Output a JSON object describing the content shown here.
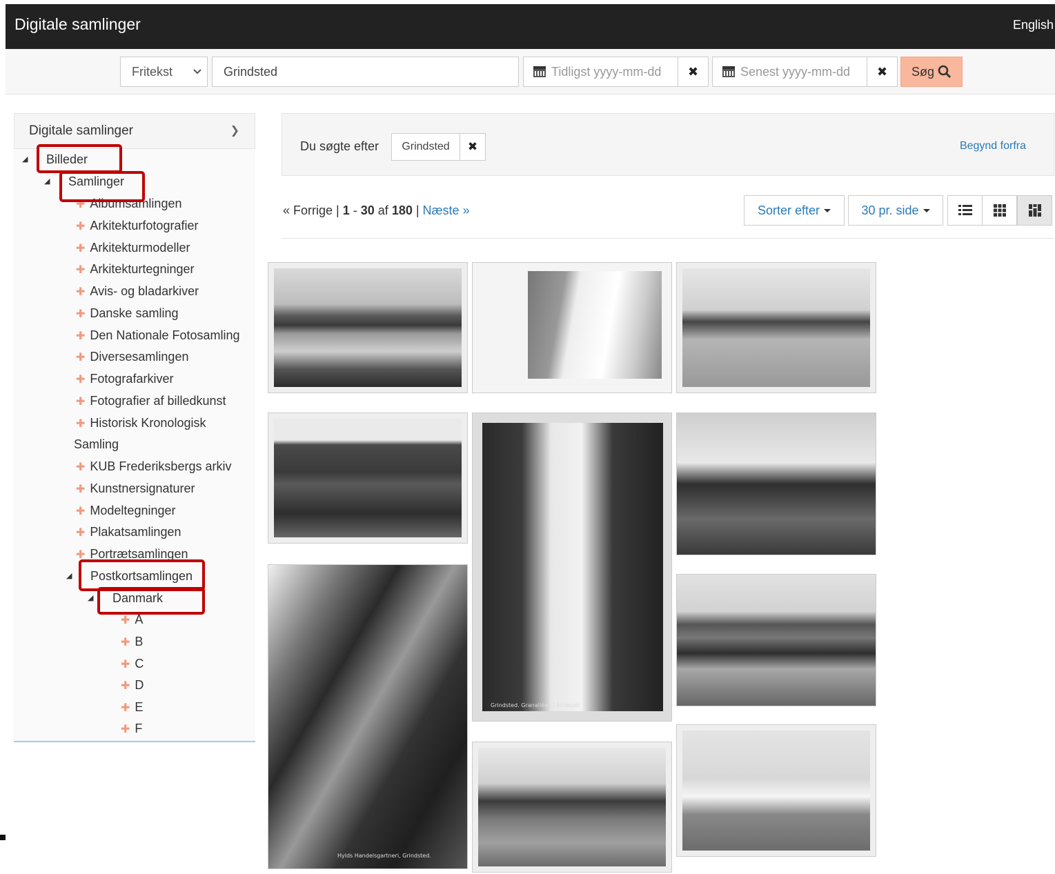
{
  "header": {
    "brand": "Digitale samlinger",
    "language": "English"
  },
  "search": {
    "field_type": "Fritekst",
    "query": "Grindsted",
    "date_from_placeholder": "Tidligst yyyy-mm-dd",
    "date_to_placeholder": "Senest yyyy-mm-dd",
    "clear_symbol": "✖",
    "submit_label": "Søg"
  },
  "sidebar": {
    "title": "Digitale samlinger",
    "root": "Billeder",
    "group": "Samlinger",
    "collections": [
      "Albumsamlingen",
      "Arkitekturfotografier",
      "Arkitekturmodeller",
      "Arkitekturtegninger",
      "Avis- og bladarkiver",
      "Danske samling",
      "Den Nationale Fotosamling",
      "Diversesamlingen",
      "Fotografarkiver",
      "Fotografier af billedkunst",
      "Historisk Kronologisk"
    ],
    "wrap_line": "Samling",
    "collections_after": [
      "KUB Frederiksbergs arkiv",
      "Kunstnersignaturer",
      "Modeltegninger",
      "Plakatsamlingen",
      "Portrætsamlingen"
    ],
    "expanded_collection": "Postkortsamlingen",
    "country": "Danmark",
    "letters": [
      "A",
      "B",
      "C",
      "D",
      "E",
      "F"
    ]
  },
  "query_bar": {
    "prefix": "Du søgte efter",
    "chip": "Grindsted",
    "chip_remove": "✖",
    "restart": "Begynd forfra"
  },
  "pagination": {
    "prev": "« Forrige",
    "range_start": "1",
    "range_end": "30",
    "of": "af",
    "total": "180",
    "next": "Næste »"
  },
  "toolbar": {
    "sort_label": "Sorter efter",
    "per_page_label": "30 pr. side"
  },
  "captions": {
    "c7": "Hylds Handelsgartneri, Grindsted.",
    "c5": "Grindsted. Granalléen i Anlæget"
  }
}
